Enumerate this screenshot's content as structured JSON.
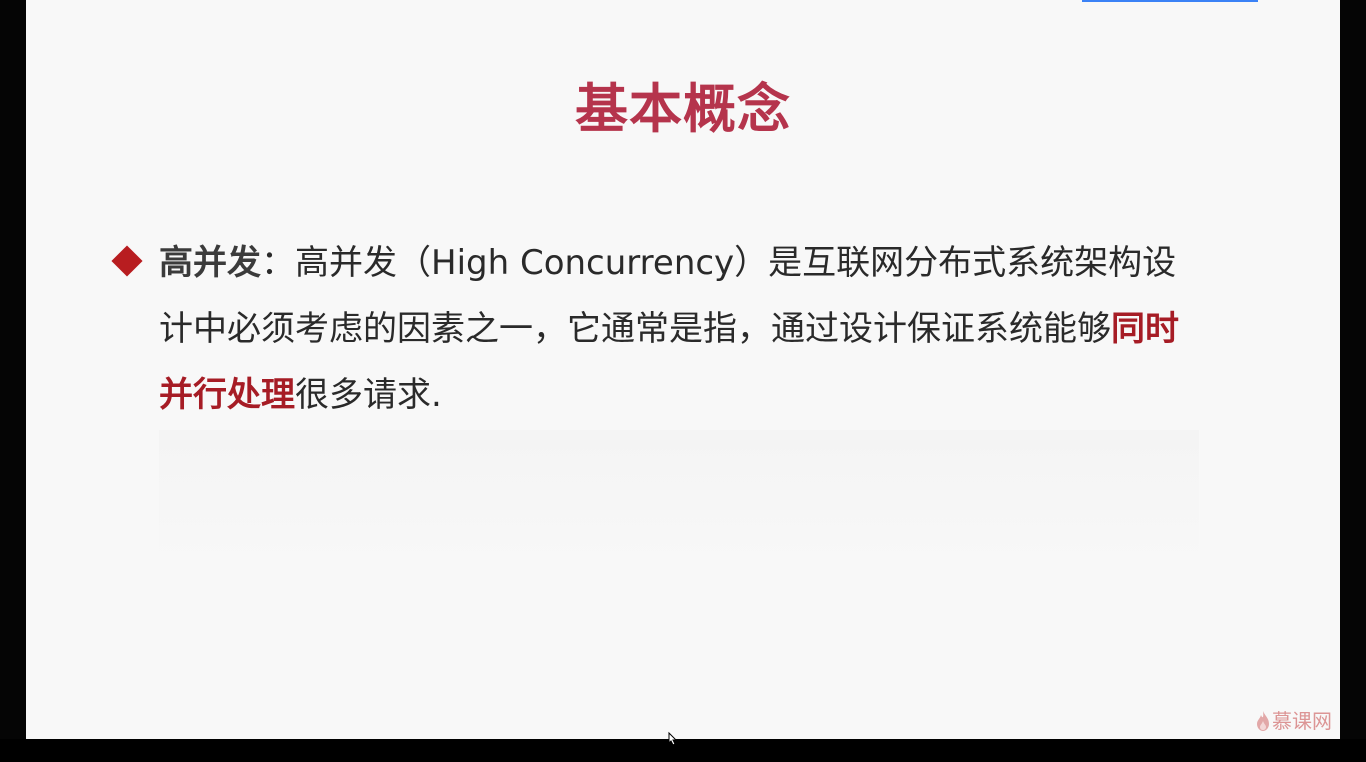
{
  "slide": {
    "title": "基本概念",
    "bullet_term": "高并发",
    "bullet_separator": "：",
    "text_part1": "高并发（High Concurrency）是互联网分布式系统架构设计中必须考虑的因素之一，它通常是指，通过设计保证系统能够",
    "highlight": "同时并行处理",
    "text_part2": "很多请求.",
    "accent_color": "#b5344c",
    "highlight_color": "#a61c25",
    "bullet_icon": "diamond-bullet-icon"
  },
  "branding": {
    "logo_text": "慕课网",
    "logo_icon": "flame-icon"
  }
}
